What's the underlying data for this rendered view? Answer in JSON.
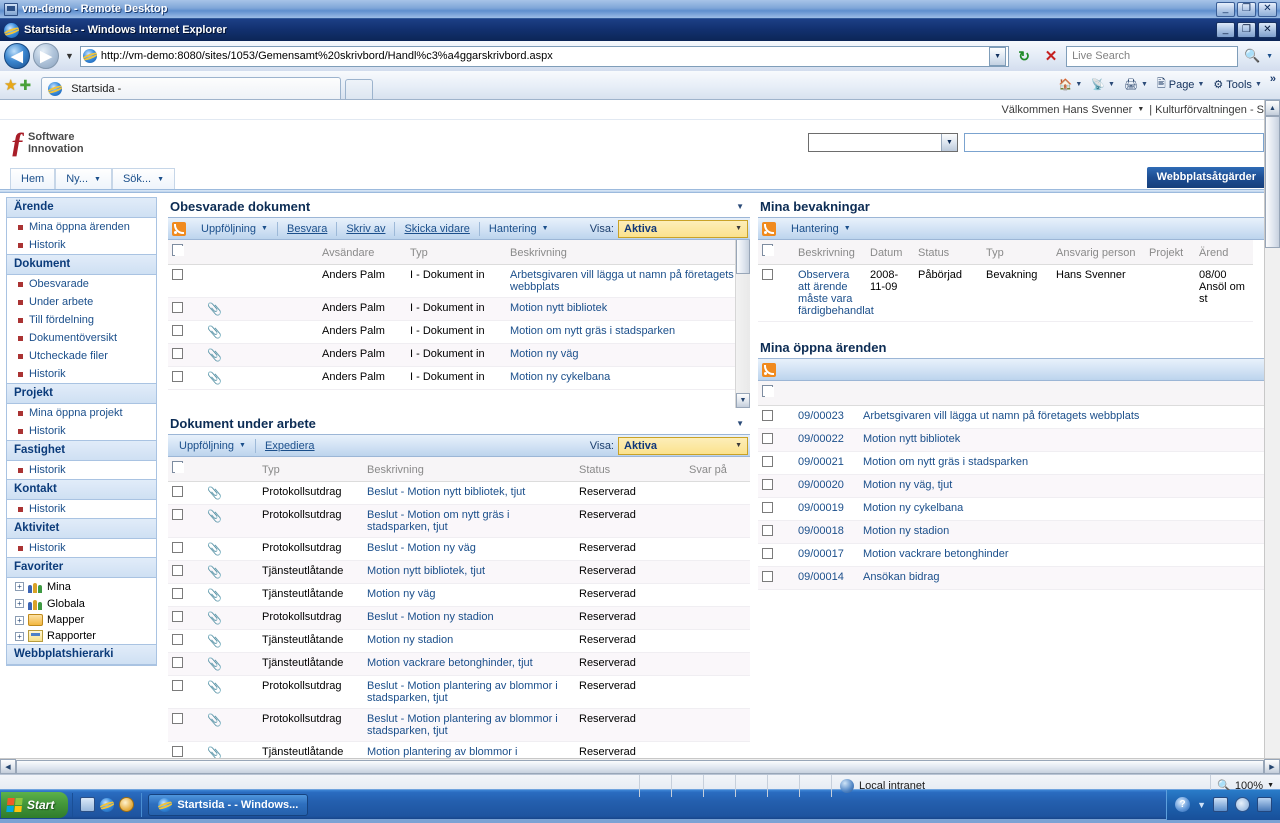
{
  "rdp": {
    "title": "vm-demo - Remote Desktop",
    "icon": "remote-desktop-icon",
    "buttons": {
      "minimize": "_",
      "restore": "❐",
      "close": "✕"
    }
  },
  "browser": {
    "title": "Startsida - - Windows Internet Explorer",
    "buttons": {
      "minimize": "_",
      "restore": "❐",
      "close": "✕"
    },
    "nav": {
      "back": "◀",
      "forward": "▶",
      "history_caret": "▼",
      "url": "http://vm-demo:8080/sites/1053/Gemensamt%20skrivbord/Handl%c3%a4ggarskrivbord.aspx",
      "url_dropdown": "▼",
      "refresh": "refresh-icon",
      "stop": "✕",
      "search_placeholder": "Live Search",
      "search_value": "",
      "search_caret": "▼"
    },
    "tab": {
      "label": "Startsida -"
    },
    "commands": [
      {
        "label": "",
        "icon": "home-icon",
        "caret": "▼"
      },
      {
        "label": "",
        "icon": "rss-feeds-icon",
        "caret": "▼"
      },
      {
        "label": "",
        "icon": "print-icon",
        "caret": "▼"
      },
      {
        "label": "Page",
        "icon": "page-icon",
        "caret": "▼"
      },
      {
        "label": "Tools",
        "icon": "tools-gear-icon",
        "caret": "▼"
      }
    ],
    "overflow": "»"
  },
  "site": {
    "welcome": "Välkommen Hans Svenner",
    "welcome_caret": "▼",
    "context": "| Kulturförvaltningen - S",
    "logo_mark": "ƒ",
    "logo_line1": "Software",
    "logo_line2": "Innovation",
    "select_value": "",
    "text_value": "",
    "site_actions": "Webbplatsåtgärder",
    "nav_tabs": [
      {
        "label": "Hem",
        "caret": ""
      },
      {
        "label": "Ny...",
        "caret": "▼"
      },
      {
        "label": "Sök...",
        "caret": "▼"
      }
    ]
  },
  "quick_launch": {
    "groups": [
      {
        "title": "Ärende",
        "items": [
          {
            "label": "Mina öppna ärenden"
          },
          {
            "label": "Historik"
          }
        ]
      },
      {
        "title": "Dokument",
        "items": [
          {
            "label": "Obesvarade"
          },
          {
            "label": "Under arbete"
          },
          {
            "label": "Till fördelning"
          },
          {
            "label": "Dokumentöversikt"
          },
          {
            "label": "Utcheckade filer"
          },
          {
            "label": "Historik"
          }
        ]
      },
      {
        "title": "Projekt",
        "items": [
          {
            "label": "Mina öppna projekt"
          },
          {
            "label": "Historik"
          }
        ]
      },
      {
        "title": "Fastighet",
        "items": [
          {
            "label": "Historik"
          }
        ]
      },
      {
        "title": "Kontakt",
        "items": [
          {
            "label": "Historik"
          }
        ]
      },
      {
        "title": "Aktivitet",
        "items": [
          {
            "label": "Historik"
          }
        ]
      }
    ],
    "favorites": {
      "title": "Favoriter",
      "expand": "+",
      "items": [
        {
          "label": "Mina",
          "icon": "people-icon"
        },
        {
          "label": "Globala",
          "icon": "people-icon"
        },
        {
          "label": "Mapper",
          "icon": "folder-icon"
        },
        {
          "label": "Rapporter",
          "icon": "report-icon"
        }
      ]
    },
    "hierarchy_title": "Webbplatshierarki"
  },
  "webparts": {
    "unanswered": {
      "title": "Obesvarade dokument",
      "menu_caret": "▼",
      "rss_icon": "rss-icon",
      "toolbar": [
        {
          "label": "Uppföljning",
          "caret": "▼"
        },
        {
          "label": "Besvara",
          "caret": ""
        },
        {
          "label": "Skriv av",
          "caret": ""
        },
        {
          "label": "Skicka vidare",
          "caret": ""
        },
        {
          "label": "Hantering",
          "caret": "▼"
        }
      ],
      "visa_label": "Visa:",
      "visa_value": "Aktiva",
      "visa_caret": "▼",
      "columns": [
        "",
        "",
        "Avsändare",
        "Typ",
        "Beskrivning"
      ],
      "rows": [
        {
          "attach": "",
          "sender": "Anders Palm",
          "type": "I - Dokument in",
          "desc": "Arbetsgivaren vill lägga ut namn på företagets webbplats"
        },
        {
          "attach": "attachment-icon",
          "sender": "Anders Palm",
          "type": "I - Dokument in",
          "desc": "Motion nytt bibliotek"
        },
        {
          "attach": "attachment-icon",
          "sender": "Anders Palm",
          "type": "I - Dokument in",
          "desc": "Motion om nytt gräs i stadsparken"
        },
        {
          "attach": "attachment-icon",
          "sender": "Anders Palm",
          "type": "I - Dokument in",
          "desc": "Motion ny väg"
        },
        {
          "attach": "attachment-icon",
          "sender": "Anders Palm",
          "type": "I - Dokument in",
          "desc": "Motion ny cykelbana"
        }
      ]
    },
    "in_progress": {
      "title": "Dokument under arbete",
      "menu_caret": "▼",
      "toolbar": [
        {
          "label": "Uppföljning",
          "caret": "▼"
        },
        {
          "label": "Expediera",
          "caret": ""
        }
      ],
      "visa_label": "Visa:",
      "visa_value": "Aktiva",
      "visa_caret": "▼",
      "columns": [
        "",
        "",
        "Typ",
        "Beskrivning",
        "Status",
        "Svar på"
      ],
      "rows": [
        {
          "type": "Protokollsutdrag",
          "desc": "Beslut - Motion nytt bibliotek, tjut",
          "status": "Reserverad",
          "svar": ""
        },
        {
          "type": "Protokollsutdrag",
          "desc": "Beslut - Motion om nytt gräs i stadsparken, tjut",
          "status": "Reserverad",
          "svar": ""
        },
        {
          "type": "Protokollsutdrag",
          "desc": "Beslut - Motion ny väg",
          "status": "Reserverad",
          "svar": ""
        },
        {
          "type": "Tjänsteutlåtande",
          "desc": "Motion nytt bibliotek, tjut",
          "status": "Reserverad",
          "svar": ""
        },
        {
          "type": "Tjänsteutlåtande",
          "desc": "Motion ny väg",
          "status": "Reserverad",
          "svar": ""
        },
        {
          "type": "Protokollsutdrag",
          "desc": "Beslut - Motion ny stadion",
          "status": "Reserverad",
          "svar": ""
        },
        {
          "type": "Tjänsteutlåtande",
          "desc": "Motion ny stadion",
          "status": "Reserverad",
          "svar": ""
        },
        {
          "type": "Tjänsteutlåtande",
          "desc": "Motion vackrare betonghinder, tjut",
          "status": "Reserverad",
          "svar": ""
        },
        {
          "type": "Protokollsutdrag",
          "desc": "Beslut - Motion plantering av blommor i stadsparken, tjut",
          "status": "Reserverad",
          "svar": ""
        },
        {
          "type": "Protokollsutdrag",
          "desc": "Beslut - Motion plantering av blommor i stadsparken, tjut",
          "status": "Reserverad",
          "svar": ""
        },
        {
          "type": "Tjänsteutlåtande",
          "desc": "Motion plantering av blommor i stadsparken, tjut",
          "status": "Reserverad",
          "svar": ""
        }
      ]
    },
    "watches": {
      "title": "Mina bevakningar",
      "menu_caret": "▼",
      "toolbar": [
        {
          "label": "Hantering",
          "caret": "▼"
        }
      ],
      "columns": [
        "",
        "Beskrivning",
        "Datum",
        "Status",
        "Typ",
        "Ansvarig person",
        "Projekt",
        "Ärend"
      ],
      "rows": [
        {
          "desc": "Observera att ärende måste vara färdigbehandlat",
          "date": "2008-11-09",
          "status": "Påbörjad",
          "type": "Bevakning",
          "person": "Hans Svenner",
          "project": "",
          "case": "08/00 Ansöl om st"
        }
      ]
    },
    "my_cases": {
      "title": "Mina öppna ärenden",
      "menu_caret": "▼",
      "columns": [
        "",
        "",
        ""
      ],
      "rows": [
        {
          "id": "09/00023",
          "desc": "Arbetsgivaren vill lägga ut namn på företagets webbplats"
        },
        {
          "id": "09/00022",
          "desc": "Motion nytt bibliotek"
        },
        {
          "id": "09/00021",
          "desc": "Motion om nytt gräs i stadsparken"
        },
        {
          "id": "09/00020",
          "desc": "Motion ny väg, tjut"
        },
        {
          "id": "09/00019",
          "desc": "Motion ny cykelbana"
        },
        {
          "id": "09/00018",
          "desc": "Motion ny stadion"
        },
        {
          "id": "09/00017",
          "desc": "Motion vackrare betonghinder"
        },
        {
          "id": "09/00014",
          "desc": "Ansökan bidrag"
        }
      ]
    }
  },
  "status_bar": {
    "zone_icon": "local-intranet-icon",
    "zone": "Local intranet",
    "zoom_icon": "zoom-icon",
    "zoom": "100%",
    "zoom_caret": "▼"
  },
  "taskbar": {
    "start": "Start",
    "quick_launch": [
      {
        "icon": "show-desktop-icon"
      },
      {
        "icon": "internet-explorer-icon"
      },
      {
        "icon": "media-icon"
      }
    ],
    "tasks": [
      {
        "icon": "internet-explorer-icon",
        "label": "Startsida - - Windows..."
      }
    ],
    "tray": [
      {
        "icon": "help-icon"
      },
      {
        "icon": "expand-tray-icon"
      },
      {
        "icon": "network-icon"
      },
      {
        "icon": "volume-icon"
      },
      {
        "icon": "app-icon"
      }
    ]
  }
}
